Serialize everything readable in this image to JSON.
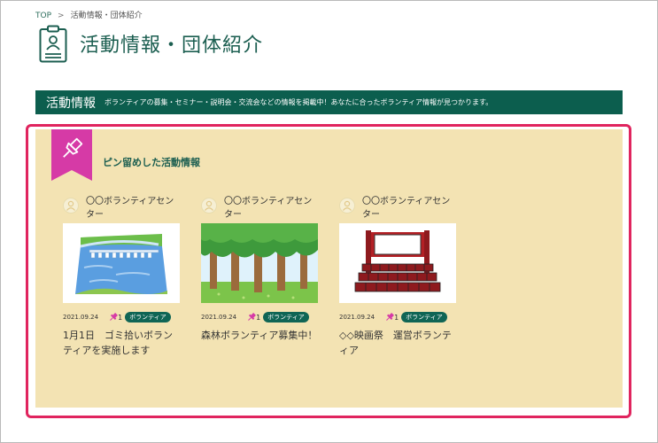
{
  "breadcrumb": {
    "home": "TOP",
    "separator": ">",
    "current": "活動情報・団体紹介"
  },
  "page_title": "活動情報・団体紹介",
  "section": {
    "title": "活動情報",
    "description": "ボランティアの募集・セミナー・説明会・交流会などの情報を掲載中！あなたに合ったボランティア情報が見つかります。"
  },
  "pinned": {
    "heading": "ピン留めした活動情報",
    "cards": [
      {
        "org": "〇〇ボランティアセンター",
        "date": "2021.09.24",
        "pins": "1",
        "tag": "ボランティア",
        "title": "1月1日　ゴミ拾いボランティアを実施します",
        "image": "river-bridge"
      },
      {
        "org": "〇〇ボランティアセンター",
        "date": "2021.09.24",
        "pins": "1",
        "tag": "ボランティア",
        "title": "森林ボランティア募集中！",
        "image": "forest"
      },
      {
        "org": "〇〇ボランティアセンター",
        "date": "2021.09.24",
        "pins": "1",
        "tag": "ボランティア",
        "title": "◇◇映画祭　運営ボランティア",
        "image": "movie-theater"
      }
    ]
  },
  "colors": {
    "brand": "#0c5e4e",
    "pin_panel": "#f3e3b3",
    "ribbon": "#d63aa6",
    "highlight": "#e0245e"
  }
}
